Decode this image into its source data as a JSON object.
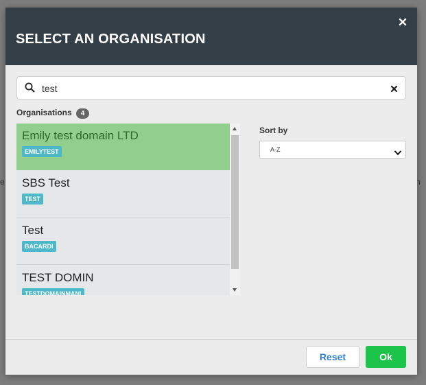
{
  "backdrop": {
    "left_edge_text": "e",
    "right_edge_text": "n"
  },
  "modal": {
    "title": "SELECT AN ORGANISATION",
    "close_icon": "close-icon"
  },
  "search": {
    "value": "test",
    "placeholder": "",
    "icon": "search-icon",
    "clear_icon": "clear-icon"
  },
  "organisations": {
    "label": "Organisations",
    "count": "4",
    "items": [
      {
        "name": "Emily test domain LTD",
        "code": "EMILYTEST",
        "selected": true
      },
      {
        "name": "SBS Test",
        "code": "TEST",
        "selected": false
      },
      {
        "name": "Test",
        "code": "BACARDI",
        "selected": false
      },
      {
        "name": "TEST DOMIN",
        "code": "TESTDOMAINMANI",
        "selected": false
      }
    ]
  },
  "sort": {
    "label": "Sort by",
    "selected": "A-Z"
  },
  "footer": {
    "reset_label": "Reset",
    "ok_label": "Ok"
  },
  "colors": {
    "header_bg": "#343e47",
    "selected_item_bg": "#91cf8e",
    "code_badge_bg": "#4db8c7",
    "ok_button_bg": "#1dc44a",
    "reset_text": "#2f7fd6"
  }
}
